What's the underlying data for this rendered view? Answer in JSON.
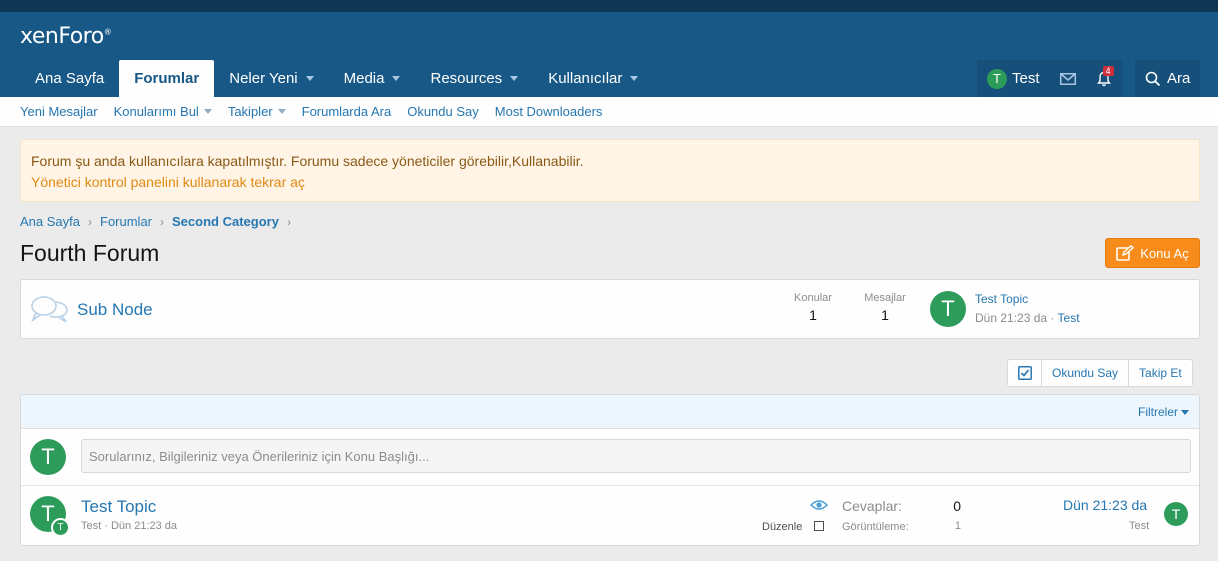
{
  "header": {
    "logo": "xenForo",
    "nav": [
      {
        "label": "Ana Sayfa"
      },
      {
        "label": "Forumlar"
      },
      {
        "label": "Neler Yeni"
      },
      {
        "label": "Media"
      },
      {
        "label": "Resources"
      },
      {
        "label": "Kullanıcılar"
      }
    ],
    "user": {
      "avatar_letter": "T",
      "name": "Test"
    },
    "alerts_count": "4",
    "search_label": "Ara"
  },
  "subnav": {
    "items": [
      {
        "label": "Yeni Mesajlar"
      },
      {
        "label": "Konularımı Bul"
      },
      {
        "label": "Takipler"
      },
      {
        "label": "Forumlarda Ara"
      },
      {
        "label": "Okundu Say"
      },
      {
        "label": "Most Downloaders"
      }
    ]
  },
  "notice": {
    "text": "Forum şu anda kullanıcılara kapatılmıştır. Forumu sadece yöneticiler görebilir,Kullanabilir.",
    "link": "Yönetici kontrol panelini kullanarak tekrar aç"
  },
  "breadcrumb": [
    "Ana Sayfa",
    "Forumlar",
    "Second Category"
  ],
  "page": {
    "title": "Fourth Forum",
    "new_thread_button": "Konu Aç"
  },
  "node": {
    "title": "Sub Node",
    "topics_label": "Konular",
    "topics_value": "1",
    "messages_label": "Mesajlar",
    "messages_value": "1",
    "last_avatar": "T",
    "last_title": "Test Topic",
    "last_time": "Dün 21:23 da",
    "last_user": "Test"
  },
  "actions": {
    "mark_read": "Okundu Say",
    "watch": "Takip Et"
  },
  "filters_label": "Filtreler",
  "quick_thread": {
    "avatar": "T",
    "placeholder": "Sorularınız, Bilgileriniz veya Önerileriniz için Konu Başlığı..."
  },
  "thread": {
    "avatar": "T",
    "mini_avatar": "T",
    "title": "Test Topic",
    "author": "Test",
    "date": "Dün 21:23 da",
    "edit_label": "Düzenle",
    "replies_label": "Cevaplar:",
    "replies_value": "0",
    "views_label": "Görüntüleme:",
    "views_value": "1",
    "last_date": "Dün 21:23 da",
    "last_user": "Test",
    "last_avatar": "T"
  },
  "colors": {
    "header_bg": "#185886",
    "link": "#2577b1",
    "button_accent": "#f78c1b",
    "avatar_green": "#2d9b5a",
    "notice_bg": "#fff4e5"
  }
}
